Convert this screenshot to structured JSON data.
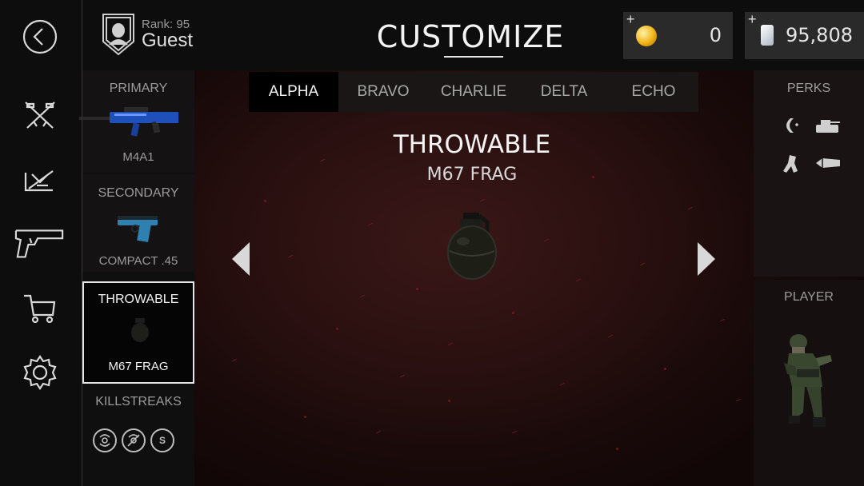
{
  "header": {
    "rank_label": "Rank: 95",
    "player_name": "Guest",
    "title": "CUSTOMIZE",
    "gold": {
      "plus": "+",
      "value": "0"
    },
    "cash": {
      "plus": "+",
      "value": "95,808"
    }
  },
  "left_nav": [
    {
      "icon": "back-arrow-icon"
    },
    {
      "icon": "crossed-rifles-icon"
    },
    {
      "icon": "attachments-icon"
    },
    {
      "icon": "pistol-icon"
    },
    {
      "icon": "shopping-cart-icon"
    },
    {
      "icon": "gear-icon"
    }
  ],
  "loadout": {
    "primary": {
      "head": "PRIMARY",
      "name": "M4A1"
    },
    "secondary": {
      "head": "SECONDARY",
      "name": "COMPACT .45"
    },
    "throwable": {
      "head": "THROWABLE",
      "name": "M67 FRAG"
    },
    "killstreaks": {
      "head": "KILLSTREAKS",
      "icons": [
        "radar-icon",
        "no-radar-icon",
        "s-badge-icon"
      ],
      "s_label": "S"
    }
  },
  "tabs": [
    {
      "label": "ALPHA",
      "active": true
    },
    {
      "label": "BRAVO",
      "active": false
    },
    {
      "label": "CHARLIE",
      "active": false
    },
    {
      "label": "DELTA",
      "active": false
    },
    {
      "label": "ECHO",
      "active": false
    }
  ],
  "center": {
    "category": "THROWABLE",
    "item_name": "M67 FRAG"
  },
  "perks": {
    "title": "PERKS",
    "icons": [
      "sound-perk-icon",
      "tank-perk-icon",
      "runner-perk-icon",
      "bullet-perk-icon"
    ]
  },
  "player": {
    "title": "PLAYER"
  },
  "colors": {
    "panel": "#0d0d0d",
    "accent_bg": "#2a1010",
    "currency_box": "#2a2a2a"
  }
}
